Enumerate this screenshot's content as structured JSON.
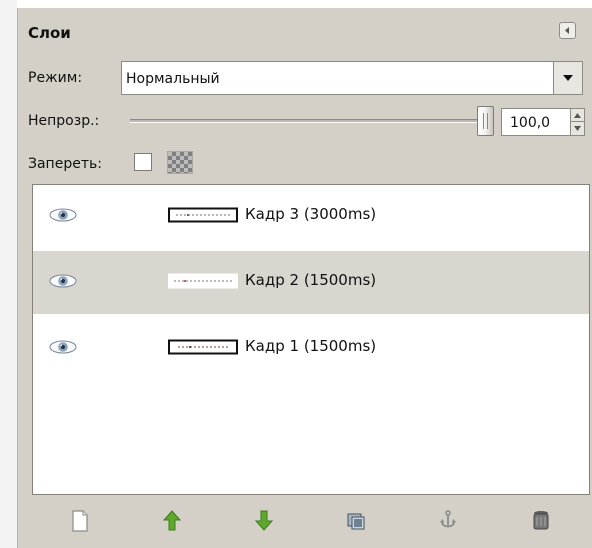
{
  "panel": {
    "title": "Слои",
    "mode_label": "Режим:",
    "mode_value": "Нормальный",
    "opacity_label": "Непрозр.:",
    "opacity_value": "100,0",
    "opacity_level": 100,
    "lock_label": "Запереть:",
    "lock_pixels_checked": false
  },
  "layers": [
    {
      "name": "Кадр 3 (3000ms)",
      "visible": true,
      "selected": false
    },
    {
      "name": "Кадр 2 (1500ms)",
      "visible": true,
      "selected": true
    },
    {
      "name": "Кадр 1 (1500ms)",
      "visible": true,
      "selected": false
    }
  ],
  "toolbar": {
    "icons": [
      "new-layer-icon",
      "raise-layer-icon",
      "lower-layer-icon",
      "duplicate-layer-icon",
      "anchor-layer-icon",
      "delete-layer-icon"
    ]
  },
  "colors": {
    "panel_background": "#d4d0c8",
    "selected_row": "#d9d5cf",
    "list_background": "#ffffff",
    "arrow_green": "#5ea82d"
  }
}
